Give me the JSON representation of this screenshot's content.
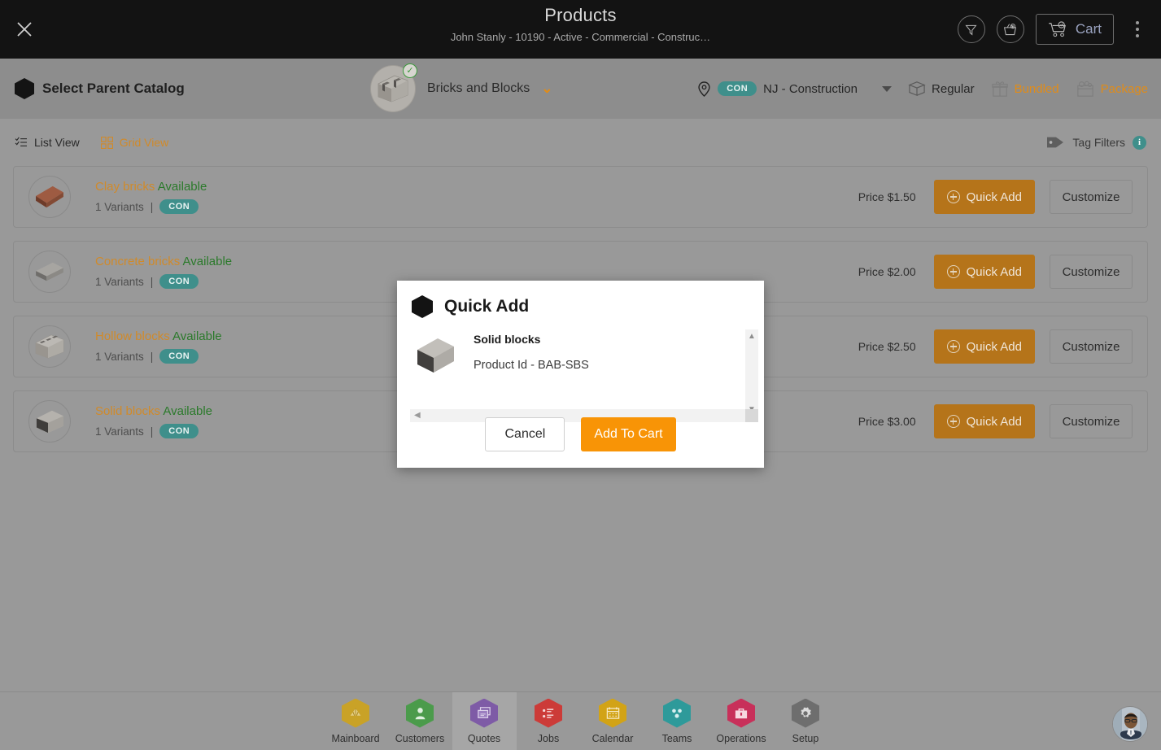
{
  "header": {
    "close_icon": "close-icon",
    "title": "Products",
    "subtitle": "John Stanly - 10190 - Active - Commercial - Construc…",
    "filter_icon": "filter-funnel-icon",
    "basket_icon": "basket-add-icon",
    "cart_icon": "cart-icon",
    "cart_label": "Cart",
    "menu_icon": "kebab-menu-icon"
  },
  "catalog_bar": {
    "hex_icon": "hexagon-icon",
    "select_parent_label": "Select Parent Catalog",
    "thumb_icon": "hollow-block-thumb",
    "check_badge": "✓",
    "catalog_name": "Bricks and Blocks",
    "caret": "⌄",
    "location_icon": "location-pin-icon",
    "location_code": "CON",
    "location_name": "NJ - Construction",
    "types": [
      {
        "label": "Regular",
        "icon": "box-icon",
        "active": true
      },
      {
        "label": "Bundled",
        "icon": "gift-icon",
        "active": false
      },
      {
        "label": "Package",
        "icon": "package-icon",
        "active": false
      }
    ]
  },
  "view_bar": {
    "list_view_label": "List View",
    "list_view_icon": "list-view-icon",
    "grid_view_label": "Grid View",
    "grid_view_icon": "grid-view-icon",
    "tag_filters_label": "Tag Filters",
    "tag_icon": "tag-icon",
    "info_icon": "i"
  },
  "products": [
    {
      "thumb": "clay-brick-thumb",
      "name": "Clay bricks",
      "status": "Available",
      "variants": "1 Variants",
      "separator": "|",
      "code": "CON",
      "price": "Price $1.50",
      "quick_add_label": "Quick Add",
      "customize_label": "Customize"
    },
    {
      "thumb": "concrete-brick-thumb",
      "name": "Concrete bricks",
      "status": "Available",
      "variants": "1 Variants",
      "separator": "|",
      "code": "CON",
      "price": "Price $2.00",
      "quick_add_label": "Quick Add",
      "customize_label": "Customize"
    },
    {
      "thumb": "hollow-block-thumb",
      "name": "Hollow blocks",
      "status": "Available",
      "variants": "1 Variants",
      "separator": "|",
      "code": "CON",
      "price": "Price $2.50",
      "quick_add_label": "Quick Add",
      "customize_label": "Customize"
    },
    {
      "thumb": "solid-block-thumb",
      "name": "Solid blocks",
      "status": "Available",
      "variants": "1 Variants",
      "separator": "|",
      "code": "CON",
      "price": "Price $3.00",
      "quick_add_label": "Quick Add",
      "customize_label": "Customize"
    }
  ],
  "modal": {
    "hex_icon": "hexagon-icon",
    "title": "Quick Add",
    "product_thumb": "solid-block-thumb",
    "product_name": "Solid blocks",
    "product_id": "Product Id - BAB-SBS",
    "scroll_up": "▲",
    "scroll_down": "▼",
    "scroll_left": "◀",
    "scroll_right": "▶",
    "cancel_label": "Cancel",
    "add_to_cart_label": "Add To Cart"
  },
  "bottom_nav": {
    "items": [
      {
        "label": "Mainboard",
        "icon": "fan-icon",
        "color": "#c9a227",
        "selected": false
      },
      {
        "label": "Customers",
        "icon": "person-icon",
        "color": "#4b9b4b",
        "selected": false
      },
      {
        "label": "Quotes",
        "icon": "quotes-icon",
        "color": "#7e5ba6",
        "selected": true
      },
      {
        "label": "Jobs",
        "icon": "tasklist-icon",
        "color": "#cc3b38",
        "selected": false
      },
      {
        "label": "Calendar",
        "icon": "calendar-icon",
        "color": "#d2a316",
        "selected": false
      },
      {
        "label": "Teams",
        "icon": "teams-icon",
        "color": "#2e9a9a",
        "selected": false
      },
      {
        "label": "Operations",
        "icon": "briefcase-icon",
        "color": "#c8305a",
        "selected": false
      },
      {
        "label": "Setup",
        "icon": "gear-icon",
        "color": "#6e6e6e",
        "selected": false
      }
    ],
    "avatar": "user-avatar"
  },
  "colors": {
    "topbar_bg": "#131313",
    "catalog_bg": "#8d8d8d",
    "page_bg": "#999999",
    "accent_orange": "#e08c19",
    "button_orange": "#b5741a",
    "primary_orange": "#f89406",
    "teal": "#3f8f8b",
    "available_green": "#2b7a2b"
  }
}
